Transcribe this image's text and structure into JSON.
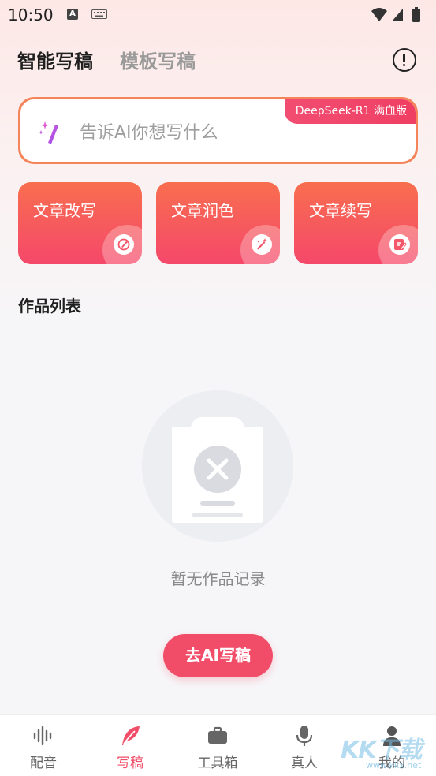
{
  "status_bar": {
    "time": "10:50",
    "notification_icon_letter": "A"
  },
  "header": {
    "tabs": [
      {
        "label": "智能写稿",
        "active": true
      },
      {
        "label": "模板写稿",
        "active": false
      }
    ]
  },
  "prompt": {
    "placeholder": "告诉AI你想写什么",
    "model_badge": "DeepSeek-R1 满血版"
  },
  "quick_actions": [
    {
      "label": "文章改写",
      "icon": "pen-icon"
    },
    {
      "label": "文章润色",
      "icon": "magic-wand-icon"
    },
    {
      "label": "文章续写",
      "icon": "edit-note-icon"
    }
  ],
  "works": {
    "title": "作品列表",
    "empty_text": "暂无作品记录",
    "cta_label": "去AI写稿"
  },
  "bottom_nav": {
    "items": [
      {
        "label": "配音",
        "icon": "waveform-icon",
        "active": false
      },
      {
        "label": "写稿",
        "icon": "feather-icon",
        "active": true
      },
      {
        "label": "工具箱",
        "icon": "toolbox-icon",
        "active": false
      },
      {
        "label": "真人",
        "icon": "microphone-icon",
        "active": false
      },
      {
        "label": "我的",
        "icon": "person-icon",
        "active": false
      }
    ]
  },
  "watermark": {
    "text": "KK下载",
    "sub": "www.kkx.net"
  },
  "colors": {
    "accent": "#f24d68",
    "orange": "#f86e4f",
    "border": "#f5845a",
    "inactive": "#9a9a9a"
  }
}
